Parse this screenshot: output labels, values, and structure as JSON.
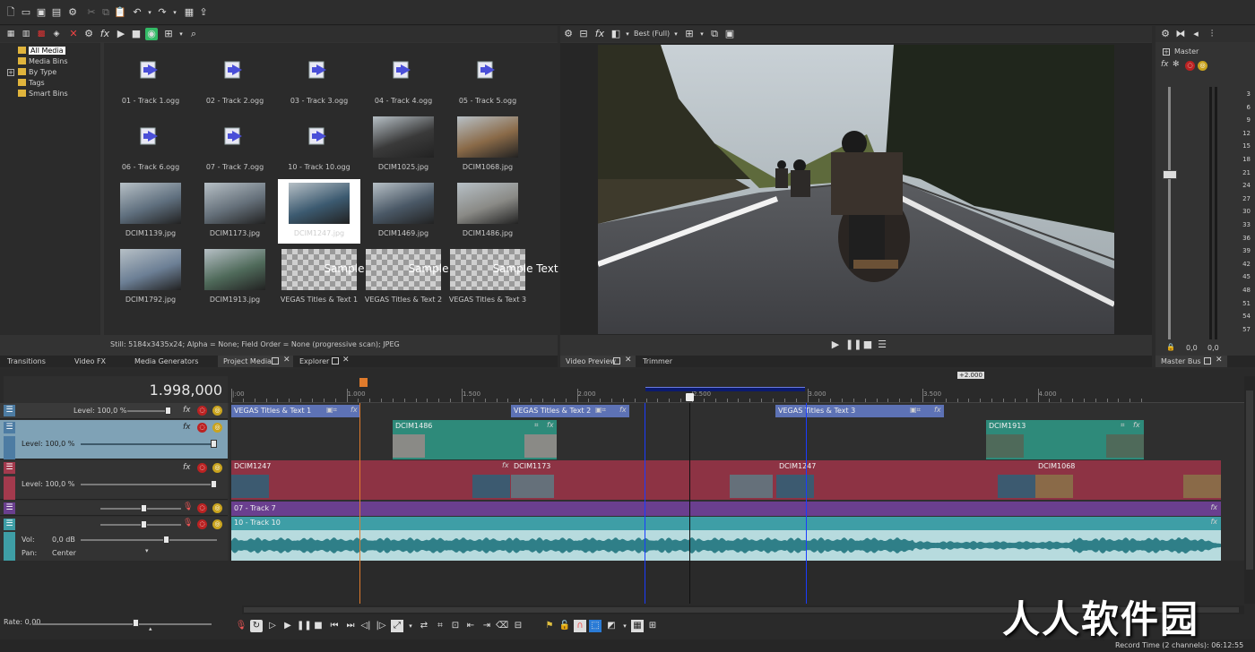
{
  "colors": {
    "video_track": "#8d3344",
    "title_track": "#5d72b5",
    "teal_track": "#2e8a7a",
    "purple_track": "#6a3f8f",
    "audio_track": "#3e9ea6",
    "selection": "#0b1a6e"
  },
  "main_toolbar": {
    "icons": [
      "new-icon",
      "open-icon",
      "save-icon",
      "save-as-icon",
      "properties-icon",
      "cut-icon",
      "copy-icon",
      "paste-icon",
      "undo-icon",
      "redo-icon",
      "render-icon",
      "upload-icon"
    ]
  },
  "explorer": {
    "tree": [
      {
        "label": "All Media",
        "selected": true
      },
      {
        "label": "Media Bins"
      },
      {
        "label": "By Type"
      },
      {
        "label": "Tags"
      },
      {
        "label": "Smart Bins"
      }
    ],
    "items": [
      {
        "caption": "01 - Track  1.ogg",
        "kind": "audio"
      },
      {
        "caption": "02 - Track  2.ogg",
        "kind": "audio"
      },
      {
        "caption": "03 - Track  3.ogg",
        "kind": "audio"
      },
      {
        "caption": "04 - Track  4.ogg",
        "kind": "audio"
      },
      {
        "caption": "05 - Track  5.ogg",
        "kind": "audio"
      },
      {
        "caption": "06 - Track  6.ogg",
        "kind": "audio"
      },
      {
        "caption": "07 - Track  7.ogg",
        "kind": "audio"
      },
      {
        "caption": "10 - Track 10.ogg",
        "kind": "audio"
      },
      {
        "caption": "DCIM1025.jpg",
        "kind": "image",
        "color": "#3a3a3a"
      },
      {
        "caption": "DCIM1068.jpg",
        "kind": "image",
        "color": "#8a6a48"
      },
      {
        "caption": "DCIM1139.jpg",
        "kind": "image",
        "color": "#5f6f7e"
      },
      {
        "caption": "DCIM1173.jpg",
        "kind": "image",
        "color": "#65707a"
      },
      {
        "caption": "DCIM1247.jpg",
        "kind": "image",
        "color": "#3c5a70",
        "selected": true
      },
      {
        "caption": "DCIM1469.jpg",
        "kind": "image",
        "color": "#4a5866"
      },
      {
        "caption": "DCIM1486.jpg",
        "kind": "image",
        "color": "#8a8a86"
      },
      {
        "caption": "DCIM1792.jpg",
        "kind": "image",
        "color": "#6c7f95"
      },
      {
        "caption": "DCIM1913.jpg",
        "kind": "image",
        "color": "#4f6a5a"
      },
      {
        "caption": "VEGAS Titles & Text 1",
        "kind": "title"
      },
      {
        "caption": "VEGAS Titles & Text 2",
        "kind": "title"
      },
      {
        "caption": "VEGAS Titles & Text 3",
        "kind": "title"
      }
    ],
    "sample_text": "Sample Text",
    "status": "Still: 5184x3435x24; Alpha = None; Field Order = None (progressive scan); JPEG"
  },
  "left_tabs": [
    "Transitions",
    "Video FX",
    "Media Generators",
    "Project Media",
    "Explorer"
  ],
  "preview": {
    "quality": "Best (Full)",
    "tabs": [
      "Video Preview",
      "Trimmer"
    ]
  },
  "master": {
    "label": "Master",
    "tab": "Master Bus",
    "scale": [
      "3",
      "6",
      "9",
      "12",
      "15",
      "18",
      "21",
      "24",
      "27",
      "30",
      "33",
      "36",
      "39",
      "42",
      "45",
      "48",
      "51",
      "54",
      "57"
    ],
    "left_value": "0,0",
    "right_value": "0,0"
  },
  "timeline": {
    "timecode": "1.998,000",
    "ruler_marks": [
      "|:00",
      "1.000",
      "1.500",
      "2.000",
      "2.500",
      "3.000",
      "3.500",
      "4.000"
    ],
    "loop_label": "+2.000",
    "tracks": [
      {
        "level": "Level: 100,0 %"
      },
      {
        "level": "Level: 100,0 %"
      },
      {
        "level": "Level: 100,0 %"
      },
      {
        "vol_label": "Vol:",
        "vol_value": "0,0 dB",
        "pan_label": "Pan:",
        "pan_value": "Center"
      }
    ],
    "clips": {
      "titles": [
        "VEGAS Titles & Text 1",
        "VEGAS Titles & Text 2",
        "VEGAS Titles & Text 3"
      ],
      "teal": [
        "DCIM1486",
        "DCIM1913"
      ],
      "video": [
        "DCIM1247",
        "DCIM1173",
        "DCIM1247",
        "DCIM1068"
      ],
      "audio_a": "07 - Track  7",
      "audio_b": "10 - Track 10"
    },
    "rate": "Rate: 0,00",
    "record_time": "Record Time (2 channels): 06:12:55"
  },
  "watermark": "人人软件园"
}
